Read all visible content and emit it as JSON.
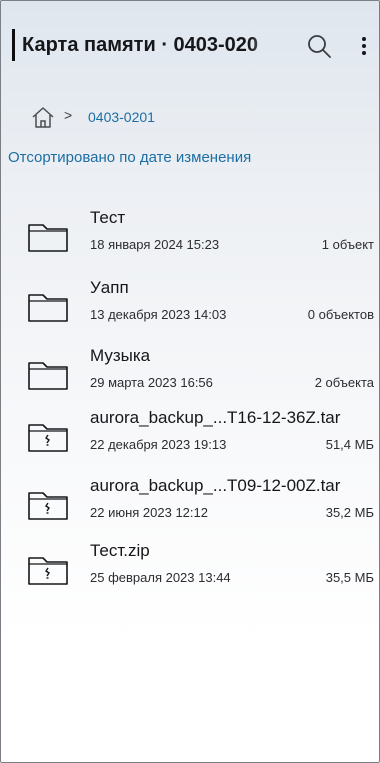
{
  "header": {
    "title": "Карта памяти · 0403-020",
    "search_icon": "search-icon",
    "more_icon": "more-vertical-icon"
  },
  "breadcrumb": {
    "home_icon": "home-icon",
    "separator": ">",
    "current": "0403-0201"
  },
  "sort_label": "Отсортировано по дате изменения",
  "colors": {
    "accent": "#1c6ea4",
    "text": "#15171b"
  },
  "items": [
    {
      "type": "folder",
      "icon": "folder-icon",
      "name": "Тест",
      "date": "18 января 2024 15:23",
      "size": "1 объект"
    },
    {
      "type": "folder",
      "icon": "folder-icon",
      "name": "Уапп",
      "date": "13 декабря 2023 14:03",
      "size": "0 объектов"
    },
    {
      "type": "folder",
      "icon": "folder-icon",
      "name": "Музыка",
      "date": "29 марта 2023 16:56",
      "size": "2 объекта"
    },
    {
      "type": "archive",
      "icon": "archive-icon",
      "name": "aurora_backup_...T16-12-36Z.tar",
      "date": "22 декабря 2023 19:13",
      "size": "51,4 МБ"
    },
    {
      "type": "archive",
      "icon": "archive-icon",
      "name": "aurora_backup_...T09-12-00Z.tar",
      "date": "22 июня 2023 12:12",
      "size": "35,2 МБ"
    },
    {
      "type": "archive",
      "icon": "archive-icon",
      "name": "Тест.zip",
      "date": "25 февраля 2023 13:44",
      "size": "35,5 МБ"
    }
  ]
}
